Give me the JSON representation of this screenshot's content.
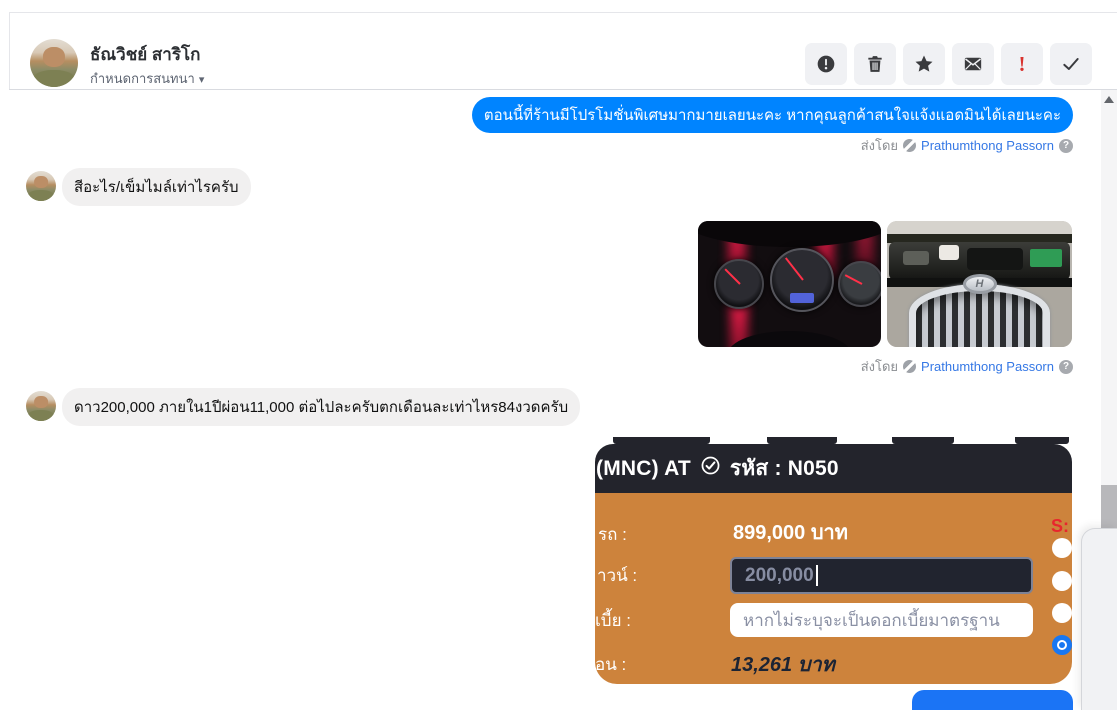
{
  "header": {
    "name": "ธัณวิชย์ สาริโก",
    "subtitle": "กำหนดการสนทนา",
    "caret": "▾",
    "toolbar": {
      "buttons": [
        {
          "icon": "alert-circle-icon"
        },
        {
          "icon": "trash-icon"
        },
        {
          "icon": "star-icon"
        },
        {
          "icon": "envelope-icon"
        },
        {
          "icon": "exclamation-icon",
          "glyph": "!",
          "color": "#d9332e"
        },
        {
          "icon": "check-icon"
        }
      ]
    }
  },
  "chat": {
    "sent_bubble": "ตอนนี้ที่ร้านมีโปรโมชั่นพิเศษมากมายเลยนะคะ หากคุณลูกค้าสนใจแจ้งแอดมินได้เลยนะคะ",
    "sent_bubble_color": "#0084ff",
    "sent_by_prefix": "ส่งโดย",
    "sent_by_name": "Prathumthong Passorn",
    "help_glyph": "?",
    "received_1": "สีอะไร/เข็มไมล์เท่าไรครับ",
    "received_2": "ดาว200,000 ภายใน1ปีผ่อน11,000 ต่อไปละครับตกเดือนละเท่าไหร84งวดครับ",
    "photos": [
      {
        "name": "car-dashboard-photo"
      },
      {
        "name": "car-engine-photo",
        "logo_letter": "H"
      }
    ]
  },
  "calculator": {
    "title_left": "(MNC) AT",
    "title_right": "รหัส : N050",
    "price_label": "รถ :",
    "price_value": "899,000 บาท",
    "down_label": "าวน์ :",
    "down_value": "200,000",
    "interest_label": "เบี้ย :",
    "interest_placeholder": "หากไม่ระบุจะเป็นดอกเบี้ยมาตรฐาน",
    "installment_label": "่อน :",
    "installment_value": "13,261 บาท",
    "red_fragment": "S:",
    "colors": {
      "header_bg": "#23242c",
      "body_bg": "#cd833c",
      "radio_selected": "#1877f2"
    }
  }
}
